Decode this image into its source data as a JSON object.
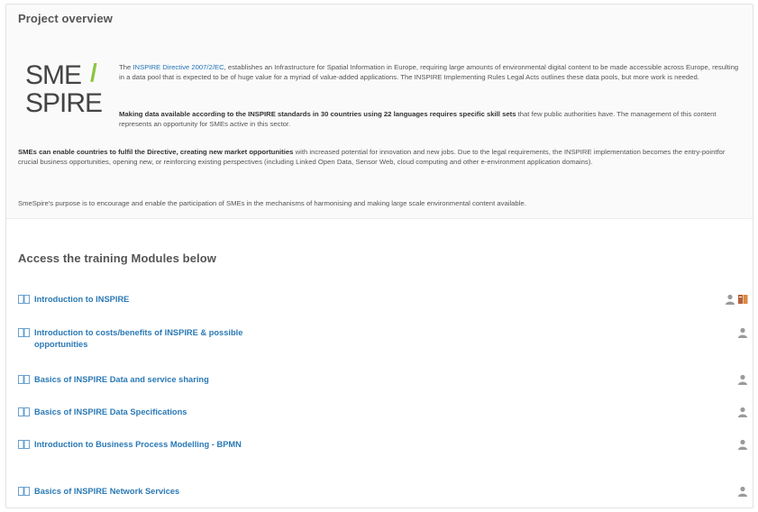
{
  "overview": {
    "title": "Project overview",
    "logo": {
      "line1": "SME",
      "slash": "/",
      "line2": "SPIRE"
    },
    "p1_link": "INSPIRE Directive 2007/2/EC",
    "p1_pre": "The ",
    "p1_post": ", establishes an Infrastructure for Spatial Information in Europe, requiring large amounts of environmental digital content to be made accessible across Europe,  resulting in a data pool that is expected to be of huge value for a myriad of value-added applications. The INSPIRE Implementing Rules Legal Acts outlines these data pools, but more work is needed.",
    "p2_bold": "Making data available according to the INSPIRE standards in 30 countries using 22 languages requires specific skill sets",
    "p2_rest": " that few public authorities have. The management of this content represents an opportunity for SMEs active in this sector.",
    "p3_bold": "SMEs can enable countries to fulfil the Directive, creating new market opportunities",
    "p3_rest": " with increased potential for innovation and new jobs. Due to the legal requirements, the INSPIRE implementation becomes the entry-pointfor crucial business opportunities, opening new, or reinforcing existing perspectives (including Linked Open Data, Sensor Web, cloud computing and other e-environment application domains).",
    "p4": "SmeSpire's purpose is to encourage and enable the participation of SMEs in the mechanisms of harmonising and making large scale environmental content available."
  },
  "modules": {
    "title": "Access the training Modules below",
    "items": [
      {
        "label": "Introduction to INSPIRE",
        "icons": [
          "person-icon",
          "trophy-icon"
        ]
      },
      {
        "label": "Introduction to costs/benefits of INSPIRE & possible opportunities",
        "icons": [
          "person-icon"
        ]
      },
      {
        "label": "Basics of INSPIRE Data and service sharing",
        "icons": [
          "person-icon"
        ]
      },
      {
        "label": "Basics of INSPIRE Data Specifications",
        "icons": [
          "person-icon"
        ]
      },
      {
        "label": "Introduction to Business Process Modelling - BPMN",
        "icons": [
          "person-icon"
        ]
      },
      {
        "label": "Basics of INSPIRE Network Services",
        "icons": [
          "person-icon"
        ]
      }
    ]
  },
  "colors": {
    "link": "#2a79b5",
    "logo_text": "#444444",
    "logo_slash": "#8cc63f",
    "trophy": "#c0504d"
  }
}
